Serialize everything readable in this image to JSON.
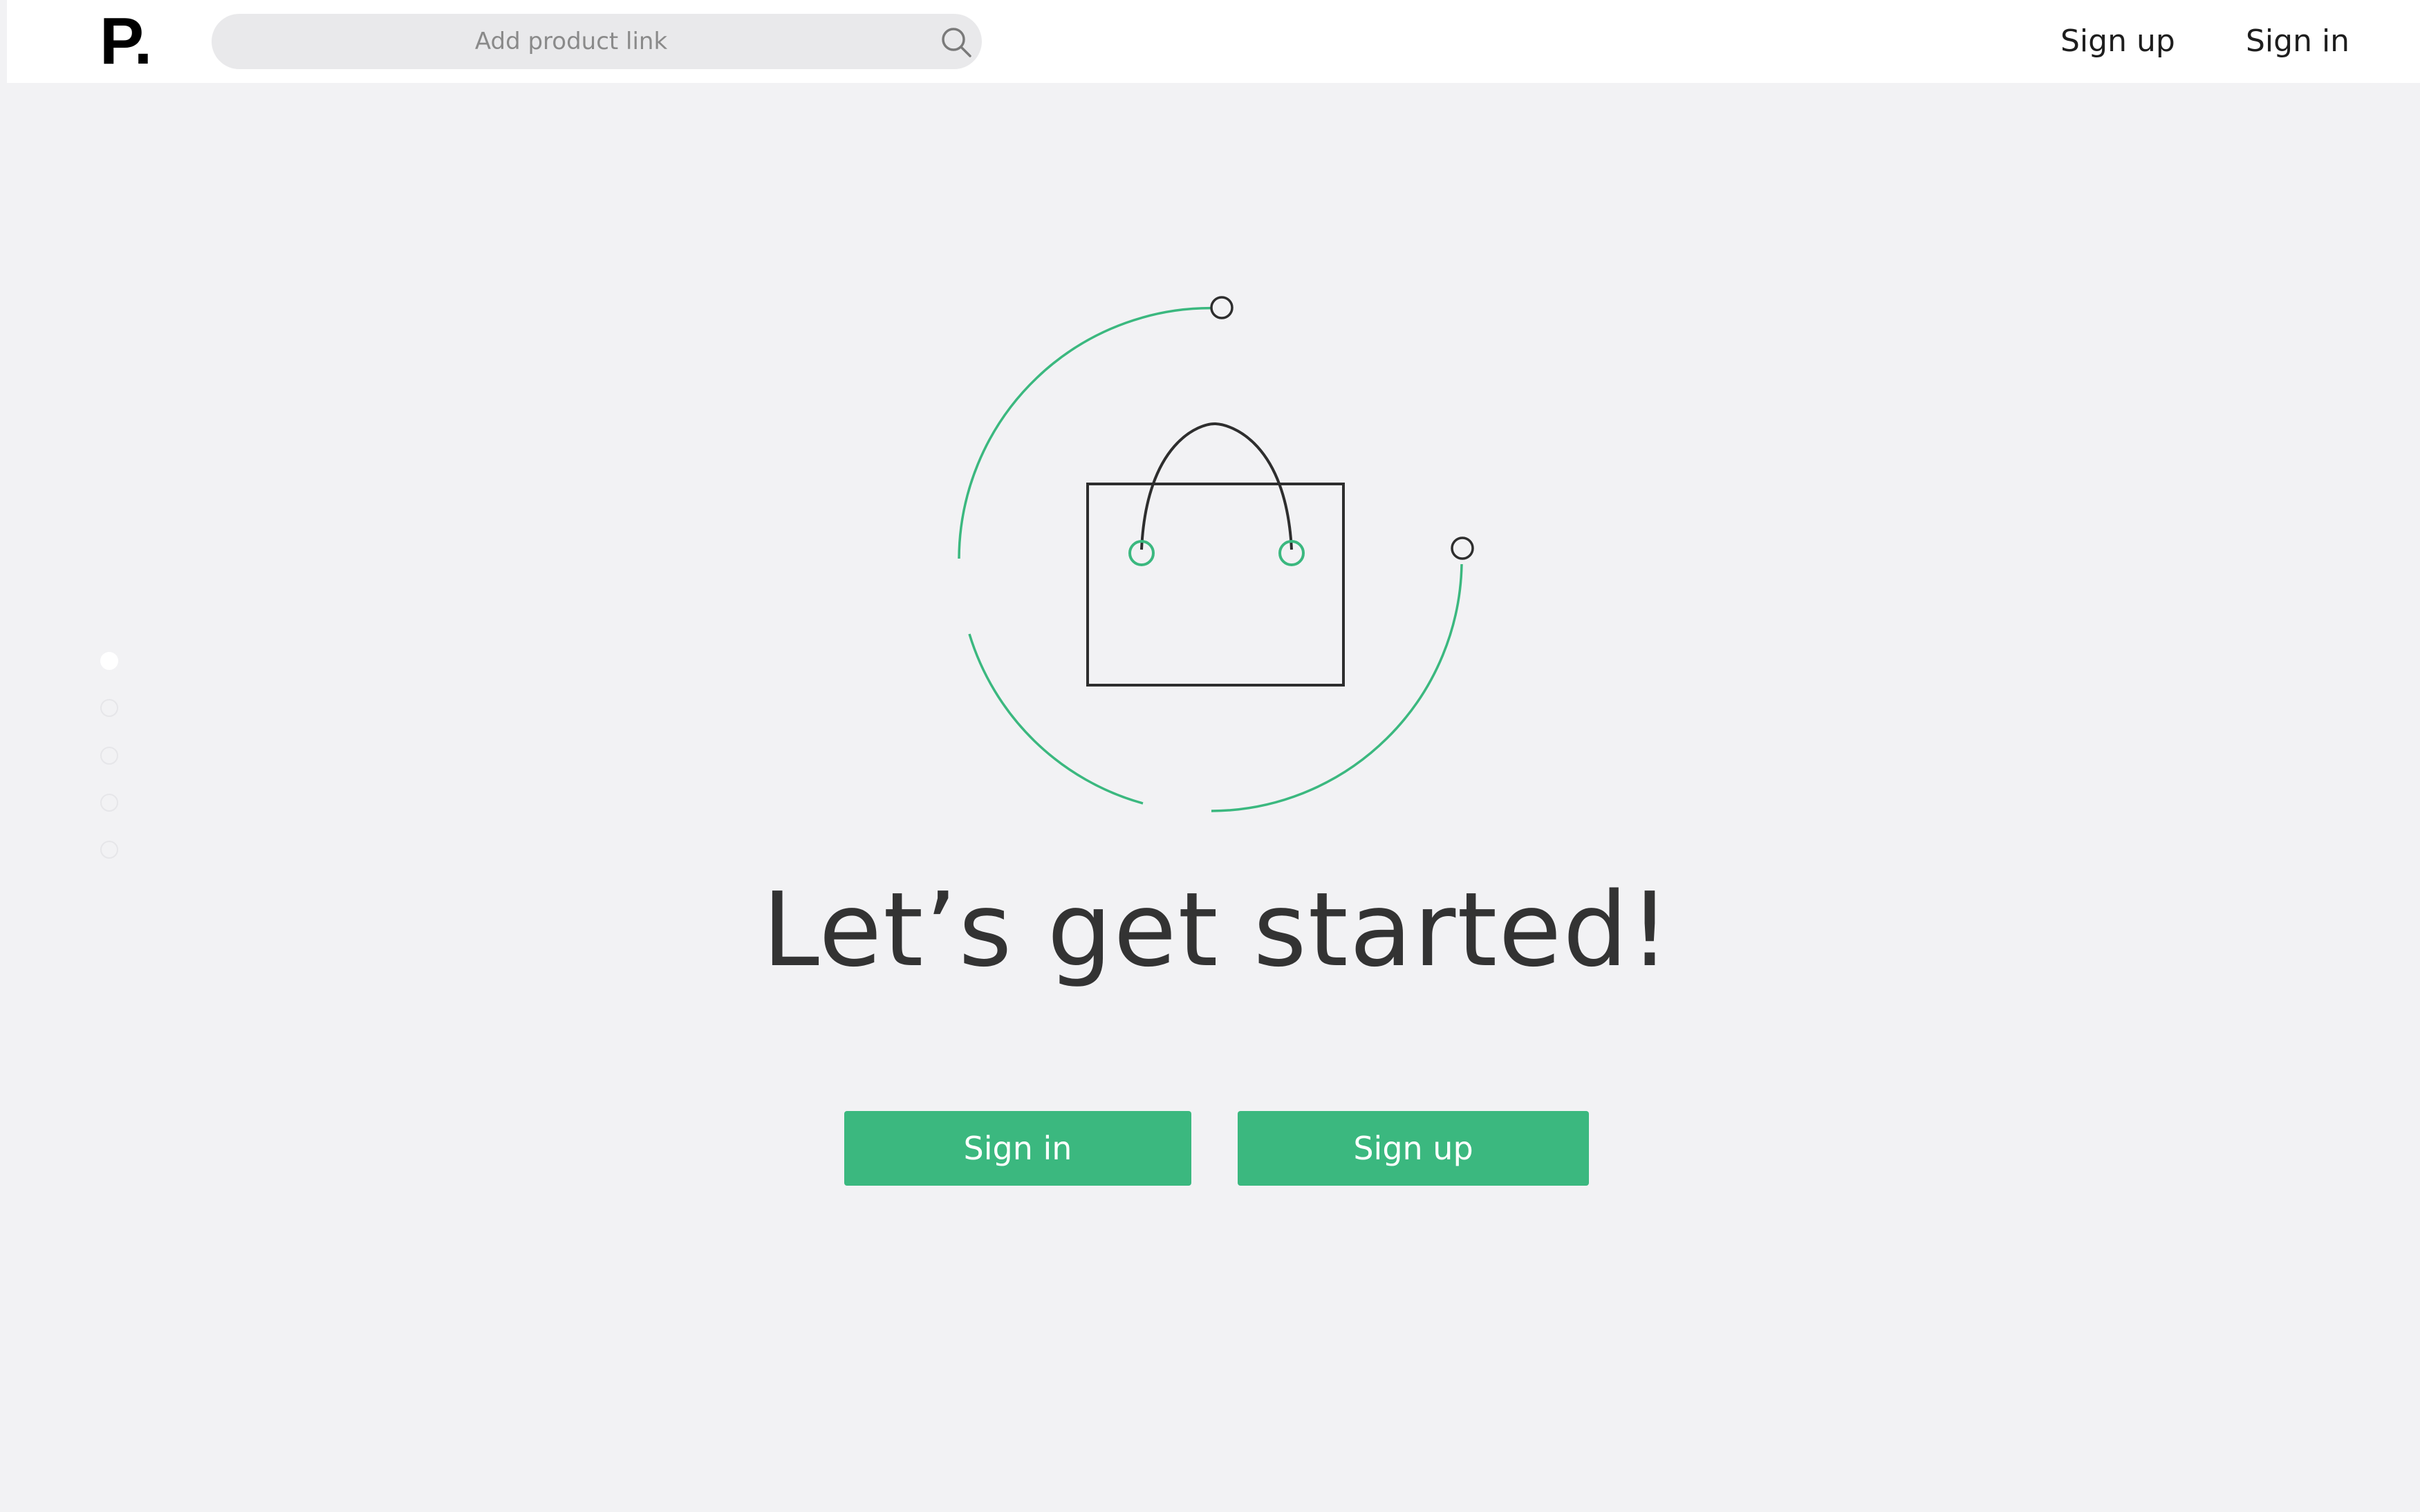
{
  "header": {
    "logo": "P.",
    "search": {
      "placeholder": "Add product link",
      "icon": "search-icon"
    },
    "nav": {
      "signup_label": "Sign up",
      "signin_label": "Sign in"
    }
  },
  "pager": {
    "count": 5,
    "active_index": 0
  },
  "main": {
    "illustration": "shopping-bag-icon",
    "headline": "Let’s get started!",
    "signin_button": "Sign in",
    "signup_button": "Sign up"
  },
  "colors": {
    "accent": "#3bb87f",
    "background": "#f2f2f4",
    "text": "#333333",
    "header_bg": "#ffffff",
    "search_bg": "#e9e9eb"
  }
}
